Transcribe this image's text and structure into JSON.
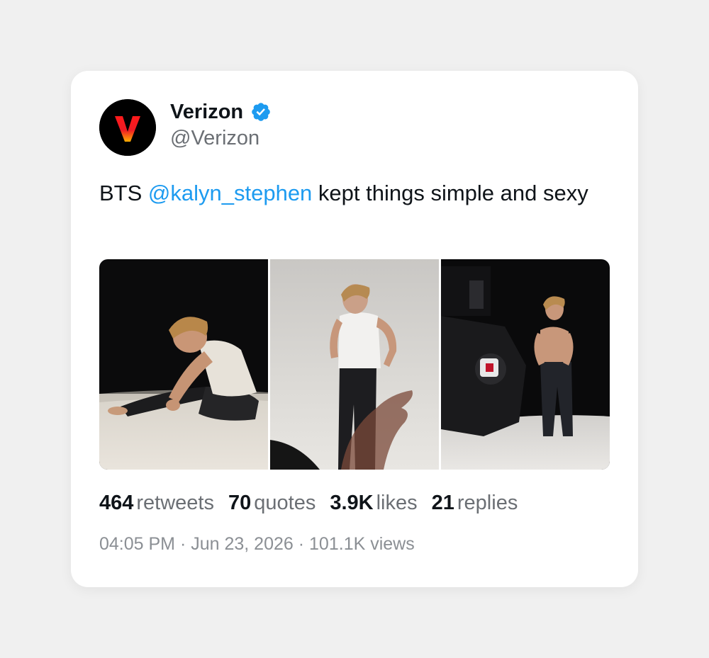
{
  "tweet": {
    "display_name": "Verizon",
    "handle": "@Verizon",
    "verified_icon": "verified-badge-icon",
    "text_prefix": "BTS ",
    "mention": "@kalyn_stephen",
    "text_suffix": " kept things simple and sexy",
    "media": [
      {
        "alt": "Man in white tank top and black leather pants seated on floor against black backdrop"
      },
      {
        "alt": "Man in white tank top and black jeans standing against light grey backdrop with blurred hand in foreground"
      },
      {
        "alt": "Shirtless man in jeans standing on set next to studio camera rig against black backdrop"
      }
    ],
    "stats": [
      {
        "value": "464",
        "label": "retweets"
      },
      {
        "value": "70",
        "label": "quotes"
      },
      {
        "value": "3.9K",
        "label": "likes"
      },
      {
        "value": "21",
        "label": "replies"
      }
    ],
    "time": "04:05 PM",
    "date": "Jun 23, 2026",
    "views": "101.1K views",
    "separator": " · "
  },
  "colors": {
    "accent": "#1d9bf0",
    "brand_red": "#e3001b",
    "text": "#0f1419",
    "muted": "#6b6f74"
  }
}
